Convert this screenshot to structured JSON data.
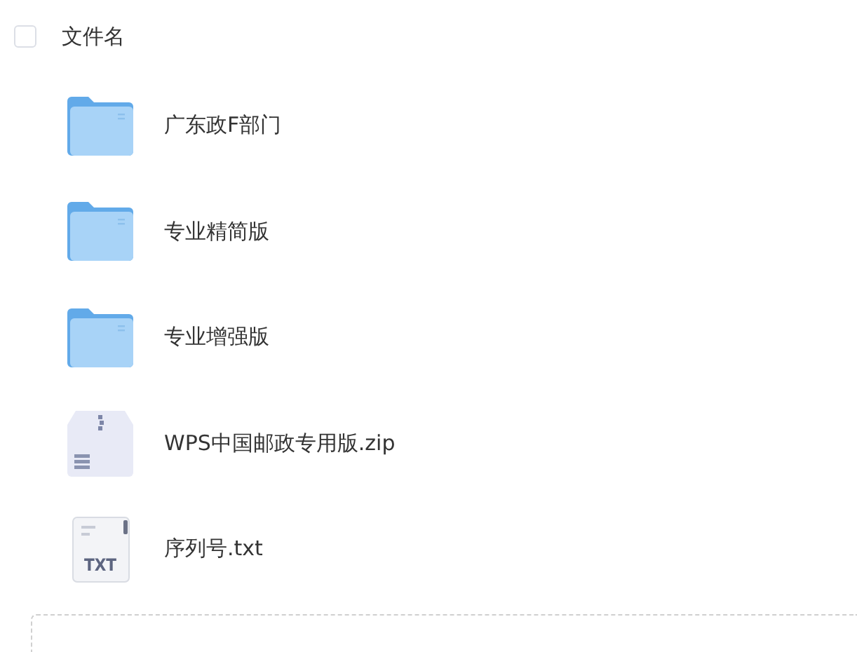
{
  "header": {
    "checked": false,
    "label": "文件名"
  },
  "files": [
    {
      "kind": "folder",
      "name": "广东政F部门"
    },
    {
      "kind": "folder",
      "name": "专业精简版"
    },
    {
      "kind": "folder",
      "name": "专业增强版"
    },
    {
      "kind": "zip",
      "name": "WPS中国邮政专用版.zip"
    },
    {
      "kind": "txt",
      "name": "序列号.txt",
      "icon_label": "TXT"
    }
  ]
}
